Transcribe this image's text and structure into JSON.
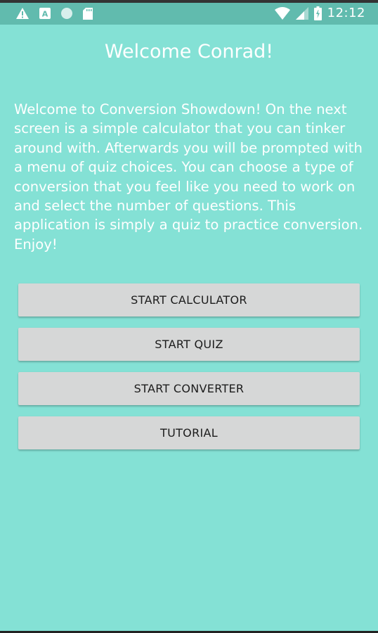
{
  "status_bar": {
    "time": "12:12",
    "left_icons": [
      "warning-icon",
      "a-notification-icon",
      "circle-notification-icon",
      "sd-card-icon"
    ],
    "right_icons": [
      "wifi-icon",
      "cell-signal-icon",
      "battery-charging-icon"
    ]
  },
  "title": "Welcome Conrad!",
  "intro": "Welcome to Conversion Showdown! On the next screen is a simple calculator that you can tinker around with. Afterwards you will be prompted with a menu of quiz choices. You can choose a type of conversion that you feel like you need to work on and select the number of questions. This application is simply a quiz to practice conversion. Enjoy!",
  "buttons": {
    "calculator": "START CALCULATOR",
    "quiz": "START QUIZ",
    "converter": "START CONVERTER",
    "tutorial": "TUTORIAL"
  },
  "colors": {
    "background": "#84e1d5",
    "status_bar": "#61bbae",
    "button": "#d6d7d7",
    "button_text": "#1c1c1c",
    "text": "#ffffff"
  }
}
